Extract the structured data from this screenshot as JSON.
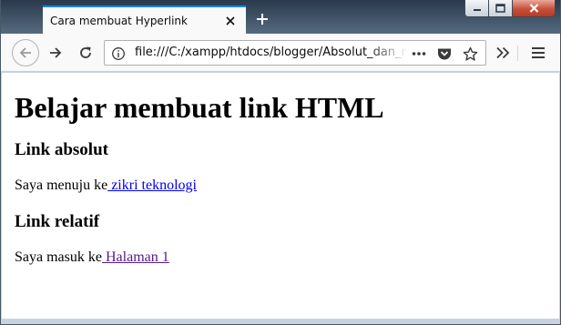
{
  "tab": {
    "title": "Cara membuat Hyperlink"
  },
  "toolbar": {
    "url": "file:///C:/xampp/htdocs/blogger/Absolut_dan_relatif.html"
  },
  "icons": {
    "tab_close": "close-icon",
    "new_tab": "plus-icon",
    "minimize": "minimize-icon",
    "maximize": "maximize-icon",
    "close": "close-icon",
    "back": "arrow-left-icon",
    "forward": "arrow-right-icon",
    "reload": "reload-icon",
    "site_info": "info-icon",
    "page_actions": "ellipsis-icon",
    "pocket": "pocket-icon",
    "bookmark": "star-icon",
    "overflow": "chevrons-right-icon",
    "menu": "hamburger-icon"
  },
  "colors": {
    "tab_accent": "#0a84ff",
    "link_unvisited": "#0000ee",
    "link_visited": "#551a8b",
    "close_button": "#c7503b"
  },
  "page": {
    "heading": "Belajar membuat link HTML",
    "sections": [
      {
        "title": "Link absolut",
        "text": "Saya menuju ke",
        "link_text": " zikri teknologi",
        "link_state": "unvisited"
      },
      {
        "title": "Link relatif",
        "text": "Saya masuk ke",
        "link_text": " Halaman 1",
        "link_state": "visited"
      }
    ]
  }
}
